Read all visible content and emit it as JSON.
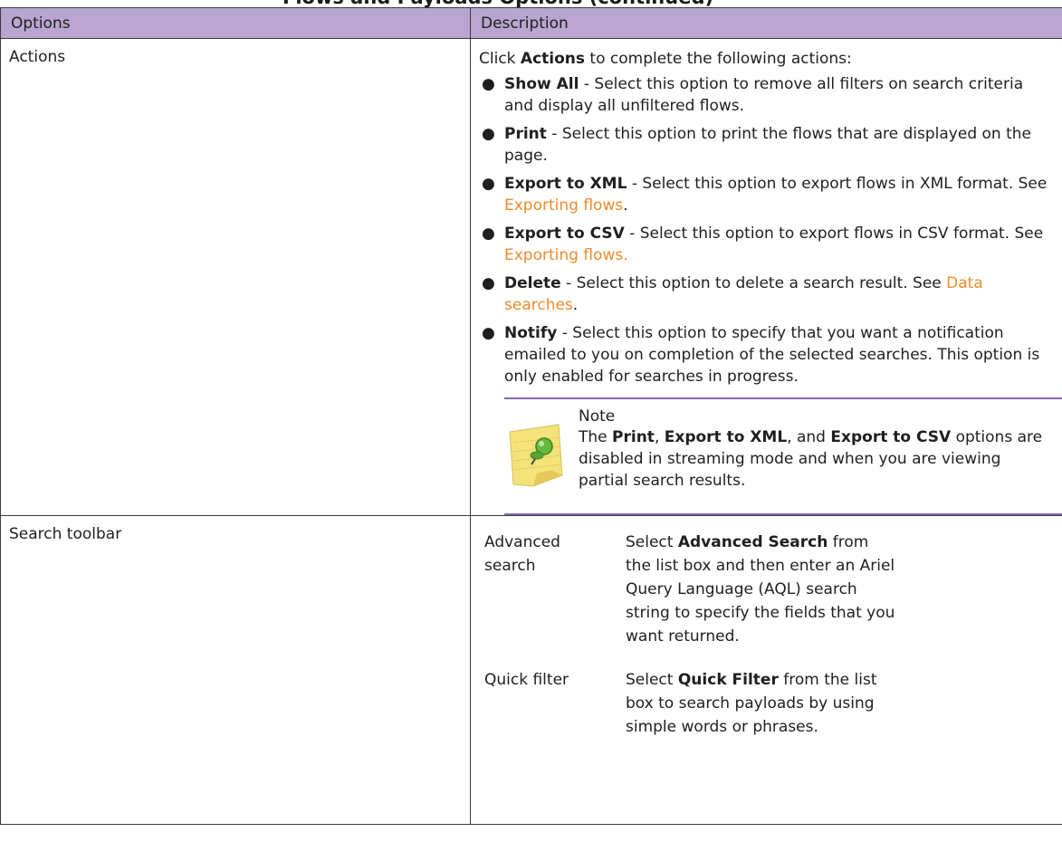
{
  "page_title_fragment": "Flows and Payloads Options (continued)",
  "table": {
    "headers": [
      "Options",
      "Description"
    ],
    "rows": [
      {
        "option": "Actions",
        "intro": {
          "pre": "Click ",
          "bold": "Actions",
          "post": " to complete the following actions:"
        },
        "items": [
          {
            "label": "Show All",
            "text": " - Select this option to remove all filters on search criteria and display all unfiltered flows.",
            "link": "",
            "tail": ""
          },
          {
            "label": "Print",
            "text": " - Select this option to print the flows that are displayed on the page.",
            "link": "",
            "tail": ""
          },
          {
            "label": "Export to XML",
            "text": " - Select this option to export flows in XML format. See ",
            "link": "Exporting flows",
            "tail": "."
          },
          {
            "label": "Export to CSV",
            "text": " - Select this option to export flows in CSV format. See ",
            "link": "Exporting flows.",
            "tail": ""
          },
          {
            "label": "Delete",
            "text": " - Select this option to delete a search result. See ",
            "link": "Data searches",
            "tail": "."
          },
          {
            "label": "Notify",
            "text": " - Select this option to specify that you want a notification emailed to you on completion of the selected searches. This option is only enabled for searches in progress.",
            "link": "",
            "tail": ""
          }
        ],
        "note": {
          "title": "Note",
          "p1": "The ",
          "b1": "Print",
          "p2": ", ",
          "b2": "Export to XML",
          "p3": ", and ",
          "b3": "Export to CSV",
          "p4": " options are disabled in streaming mode and when you are viewing partial search results."
        }
      },
      {
        "option": "Search toolbar",
        "entries": [
          {
            "term": "Advanced search",
            "pre": "Select ",
            "bold": "Advanced Search",
            "post": " from the list box and then enter an Ariel Query Language (AQL) search string to specify the fields that you want returned."
          },
          {
            "term": "Quick filter",
            "pre": "Select ",
            "bold": "Quick Filter",
            "post": " from the list box to search payloads by using simple words or phrases."
          }
        ]
      }
    ]
  }
}
